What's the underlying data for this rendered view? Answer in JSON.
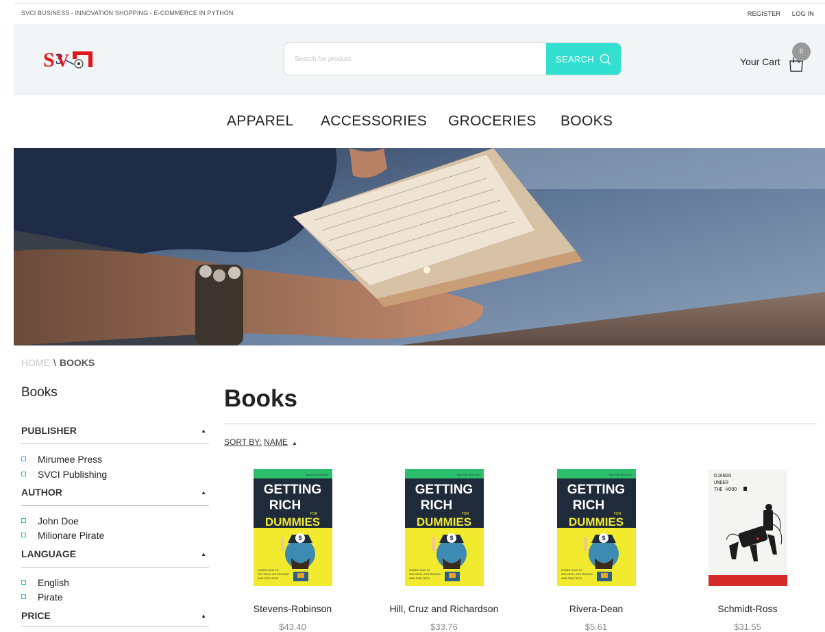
{
  "topbar": {
    "tagline": "SVCI BUSINESS - INNOVATION SHOPPING - E-COMMERCE IN PYTHON",
    "register": "REGISTER",
    "login": "LOG IN"
  },
  "header": {
    "logo_text": "SVCI",
    "search_placeholder": "Search for product",
    "search_button": "SEARCH",
    "cart_label": "Your Cart",
    "cart_count": "0"
  },
  "nav": {
    "items": [
      "APPAREL",
      "ACCESSORIES",
      "GROCERIES",
      "BOOKS"
    ]
  },
  "breadcrumb": {
    "home": "HOME",
    "separator": "\\",
    "current": "BOOKS"
  },
  "sidebar": {
    "title": "Books",
    "filters": [
      {
        "heading": "PUBLISHER",
        "options": [
          "Mirumee Press",
          "SVCI Publishing"
        ]
      },
      {
        "heading": "AUTHOR",
        "options": [
          "John Doe",
          "Milionare Pirate"
        ]
      },
      {
        "heading": "LANGUAGE",
        "options": [
          "English",
          "Pirate"
        ]
      },
      {
        "heading": "PRICE",
        "options": []
      }
    ]
  },
  "main": {
    "title": "Books",
    "sort_label": "SORT BY:",
    "sort_value": "NAME",
    "products": [
      {
        "name": "Stevens-Robinson",
        "price": "$43.40",
        "cover": "getting-rich-for-dummies"
      },
      {
        "name": "Hill, Cruz and Richardson",
        "price": "$33.76",
        "cover": "getting-rich-for-dummies"
      },
      {
        "name": "Rivera-Dean",
        "price": "$5.61",
        "cover": "getting-rich-for-dummies"
      },
      {
        "name": "Schmidt-Ross",
        "price": "$31.55",
        "cover": "django-under-the-hood"
      }
    ],
    "cover_text": {
      "edition": "SALEOR EDITION",
      "line1": "GETTING",
      "line2": "RICH",
      "for": "FOR",
      "dummies": "DUMMIES",
      "blurb1": "LEARN HOW TO",
      "blurb2": "GET RICH, GET RICHER",
      "blurb3": "AND STAY RICH",
      "django1": "DJANGO",
      "django2": "UNDER",
      "django3": "THE HOOD"
    }
  },
  "colors": {
    "accent": "#33e0cf",
    "header_bg": "#f1f5f5",
    "checkbox_border": "#21b7c7",
    "logo_red": "#e0161b"
  }
}
